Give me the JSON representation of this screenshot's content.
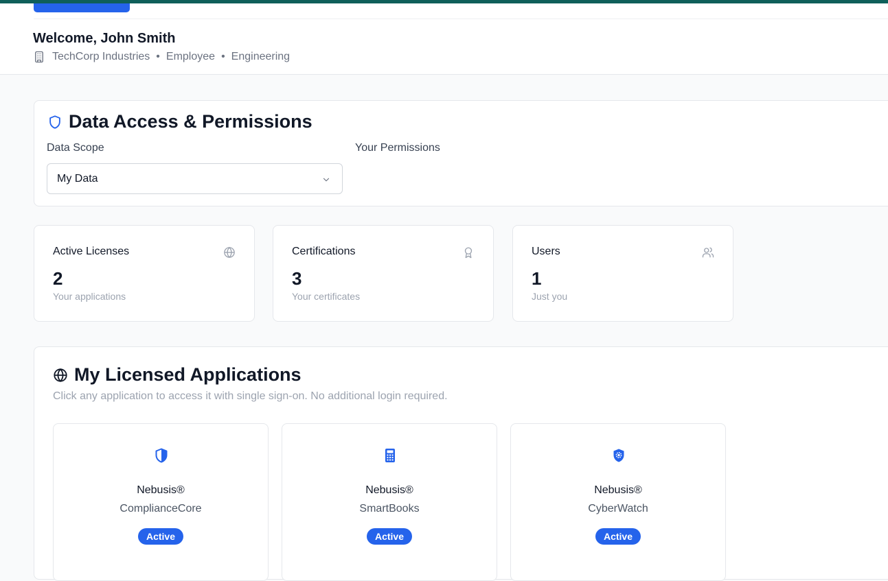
{
  "header": {
    "welcome": "Welcome, John Smith",
    "company": "TechCorp Industries",
    "role": "Employee",
    "department": "Engineering",
    "separator": "•"
  },
  "permissions": {
    "title": "Data Access & Permissions",
    "scope_label": "Data Scope",
    "scope_value": "My Data",
    "your_permissions_label": "Your Permissions"
  },
  "stats": [
    {
      "title": "Active Licenses",
      "value": "2",
      "desc": "Your applications",
      "icon": "globe-icon"
    },
    {
      "title": "Certifications",
      "value": "3",
      "desc": "Your certificates",
      "icon": "award-icon"
    },
    {
      "title": "Users",
      "value": "1",
      "desc": "Just you",
      "icon": "users-icon"
    }
  ],
  "apps": {
    "title": "My Licensed Applications",
    "description": "Click any application to access it with single sign-on. No additional login required.",
    "items": [
      {
        "brand": "Nebusis®",
        "name": "ComplianceCore",
        "status": "Active",
        "icon": "shield-half-icon"
      },
      {
        "brand": "Nebusis®",
        "name": "SmartBooks",
        "status": "Active",
        "icon": "calculator-icon"
      },
      {
        "brand": "Nebusis®",
        "name": "CyberWatch",
        "status": "Active",
        "icon": "shield-gear-icon"
      }
    ]
  },
  "colors": {
    "accent": "#2563eb",
    "topbar": "#0f5f5a"
  }
}
